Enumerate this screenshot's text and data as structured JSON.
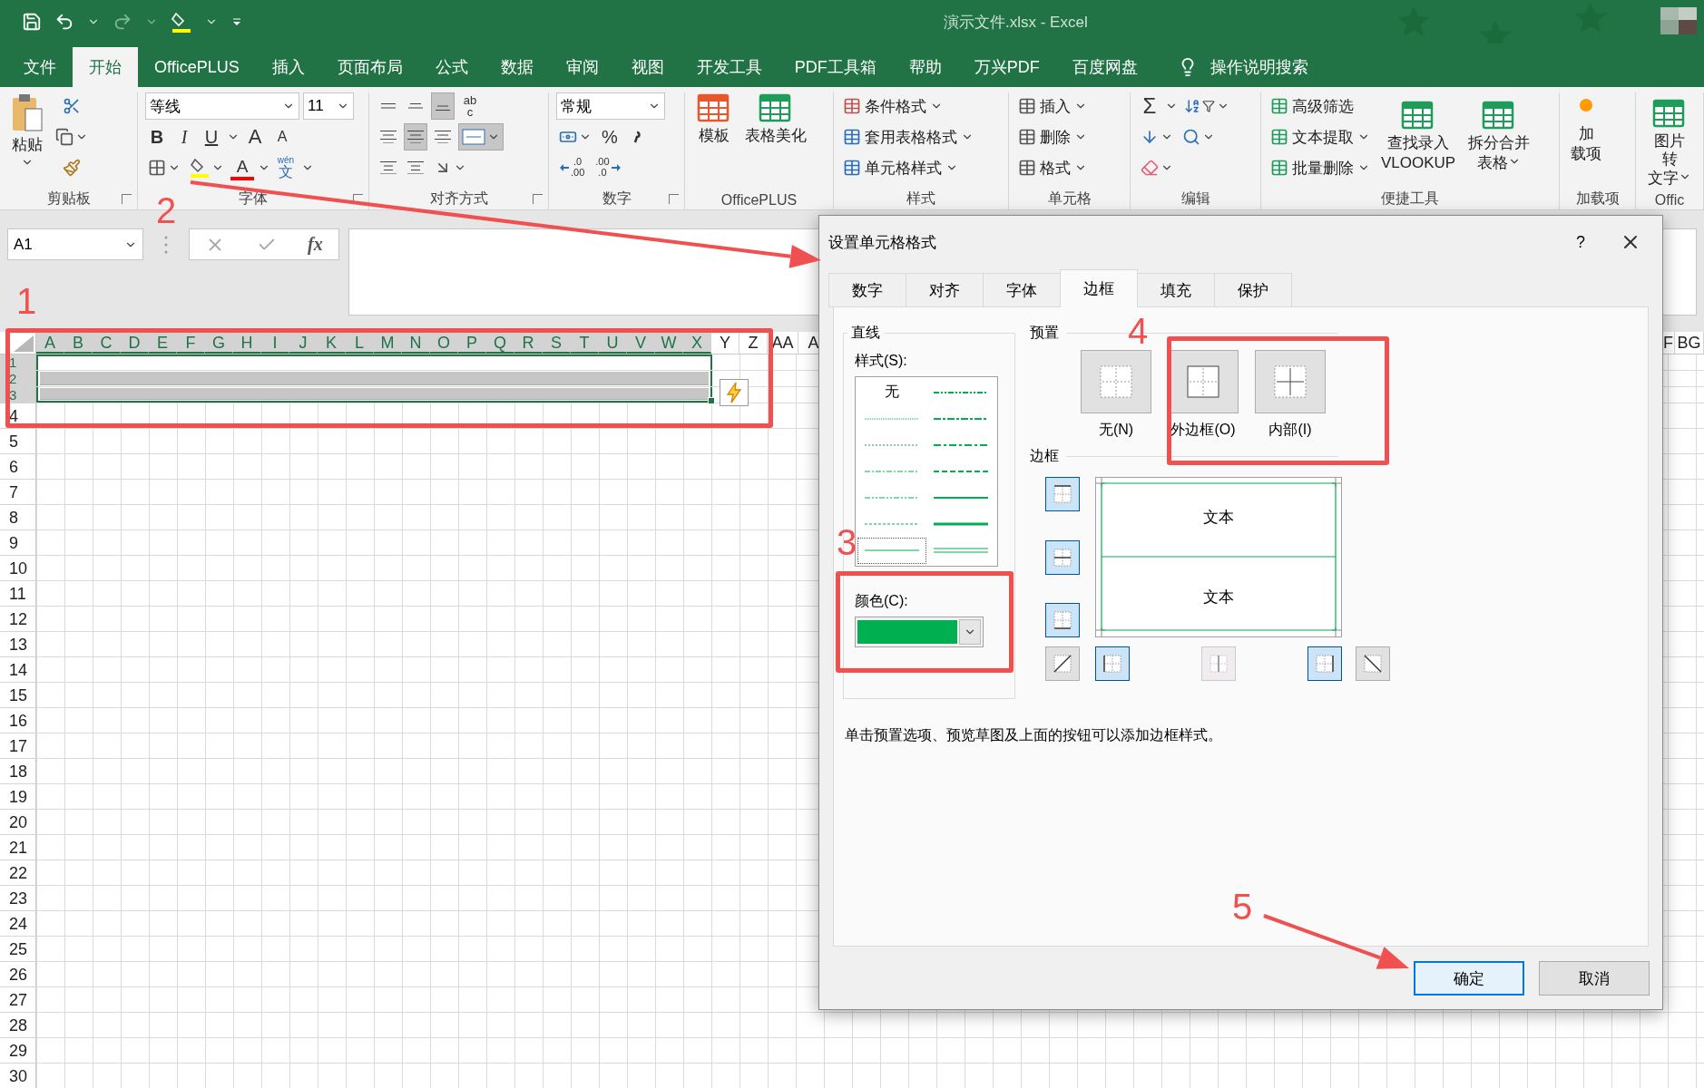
{
  "title_bar": {
    "title": "演示文件.xlsx  -  Excel"
  },
  "menu_tabs": [
    {
      "label": "文件",
      "selected": false
    },
    {
      "label": "开始",
      "selected": true
    },
    {
      "label": "OfficePLUS",
      "selected": false
    },
    {
      "label": "插入",
      "selected": false
    },
    {
      "label": "页面布局",
      "selected": false
    },
    {
      "label": "公式",
      "selected": false
    },
    {
      "label": "数据",
      "selected": false
    },
    {
      "label": "审阅",
      "selected": false
    },
    {
      "label": "视图",
      "selected": false
    },
    {
      "label": "开发工具",
      "selected": false
    },
    {
      "label": "PDF工具箱",
      "selected": false
    },
    {
      "label": "帮助",
      "selected": false
    },
    {
      "label": "万兴PDF",
      "selected": false
    },
    {
      "label": "百度网盘",
      "selected": false
    }
  ],
  "tell_me": "操作说明搜索",
  "ribbon": {
    "clipboard": {
      "paste": "粘贴",
      "label": "剪贴板"
    },
    "font": {
      "name": "等线",
      "size": "11",
      "bold": "B",
      "italic": "I",
      "underline": "U",
      "grow": "A",
      "shrink": "A",
      "color_button": "A",
      "phonetic_top": "wén",
      "phonetic": "文",
      "label": "字体"
    },
    "alignment": {
      "wrap_top": "ab",
      "wrap_bottom": "c",
      "label": "对齐方式"
    },
    "number": {
      "format": "常规",
      "percent": "%",
      "inc_decimal": [
        ".0",
        ".00"
      ],
      "dec_decimal": [
        ".00",
        ".0"
      ],
      "label": "数字"
    },
    "officeplus": {
      "buttons": [
        "模板",
        "表格美化"
      ],
      "label": "OfficePLUS"
    },
    "styles": {
      "buttons": [
        "条件格式",
        "套用表格格式",
        "单元格样式"
      ],
      "label": "样式"
    },
    "cells": {
      "buttons": [
        "插入",
        "删除",
        "格式"
      ],
      "label": "单元格"
    },
    "editing": {
      "sum": "Σ",
      "label": "编辑"
    },
    "tools": {
      "small": [
        "高级筛选",
        "文本提取",
        "批量删除"
      ],
      "large": [
        [
          "查找录入",
          "VLOOKUP"
        ],
        [
          "拆分合并",
          "表格"
        ]
      ],
      "label": "便捷工具"
    },
    "addins": {
      "button": [
        "加",
        "载项"
      ],
      "label": "加载项"
    },
    "picture_text": {
      "button": [
        "图片转",
        "文字"
      ],
      "label": "Offic"
    }
  },
  "formula_bar": {
    "name_box": "A1",
    "fx": "fx"
  },
  "sheet": {
    "columns": [
      {
        "label": "A",
        "selected": true
      },
      {
        "label": "B",
        "selected": true
      },
      {
        "label": "C",
        "selected": true
      },
      {
        "label": "D",
        "selected": true
      },
      {
        "label": "E",
        "selected": true
      },
      {
        "label": "F",
        "selected": true
      },
      {
        "label": "G",
        "selected": true
      },
      {
        "label": "H",
        "selected": true
      },
      {
        "label": "I",
        "selected": true
      },
      {
        "label": "J",
        "selected": true
      },
      {
        "label": "K",
        "selected": true
      },
      {
        "label": "L",
        "selected": true
      },
      {
        "label": "M",
        "selected": true
      },
      {
        "label": "N",
        "selected": true
      },
      {
        "label": "O",
        "selected": true
      },
      {
        "label": "P",
        "selected": true
      },
      {
        "label": "Q",
        "selected": true
      },
      {
        "label": "R",
        "selected": true
      },
      {
        "label": "S",
        "selected": true
      },
      {
        "label": "T",
        "selected": true
      },
      {
        "label": "U",
        "selected": true
      },
      {
        "label": "V",
        "selected": true
      },
      {
        "label": "W",
        "selected": true
      },
      {
        "label": "X",
        "selected": true
      },
      {
        "label": "Y",
        "selected": false
      },
      {
        "label": "Z",
        "selected": false
      },
      {
        "label": "AA",
        "selected": false
      },
      {
        "label": "A",
        "selected": false
      }
    ],
    "right_columns": [
      "F",
      "BG"
    ],
    "rows": [
      {
        "label": "1",
        "selected": true,
        "filled": false
      },
      {
        "label": "2",
        "selected": true,
        "filled": true
      },
      {
        "label": "3",
        "selected": true,
        "filled": true
      },
      {
        "label": "4",
        "selected": false,
        "filled": false
      },
      {
        "label": "5",
        "selected": false,
        "filled": false
      },
      {
        "label": "6",
        "selected": false,
        "filled": false
      },
      {
        "label": "7",
        "selected": false,
        "filled": false
      },
      {
        "label": "8",
        "selected": false,
        "filled": false
      },
      {
        "label": "9",
        "selected": false,
        "filled": false
      },
      {
        "label": "10",
        "selected": false,
        "filled": false
      },
      {
        "label": "11",
        "selected": false,
        "filled": false
      },
      {
        "label": "12",
        "selected": false,
        "filled": false
      },
      {
        "label": "13",
        "selected": false,
        "filled": false
      },
      {
        "label": "14",
        "selected": false,
        "filled": false
      },
      {
        "label": "15",
        "selected": false,
        "filled": false
      },
      {
        "label": "16",
        "selected": false,
        "filled": false
      },
      {
        "label": "17",
        "selected": false,
        "filled": false
      },
      {
        "label": "18",
        "selected": false,
        "filled": false
      },
      {
        "label": "19",
        "selected": false,
        "filled": false
      },
      {
        "label": "20",
        "selected": false,
        "filled": false
      },
      {
        "label": "21",
        "selected": false,
        "filled": false
      },
      {
        "label": "22",
        "selected": false,
        "filled": false
      },
      {
        "label": "23",
        "selected": false,
        "filled": false
      },
      {
        "label": "24",
        "selected": false,
        "filled": false
      },
      {
        "label": "25",
        "selected": false,
        "filled": false
      },
      {
        "label": "26",
        "selected": false,
        "filled": false
      },
      {
        "label": "27",
        "selected": false,
        "filled": false
      },
      {
        "label": "28",
        "selected": false,
        "filled": false
      },
      {
        "label": "29",
        "selected": false,
        "filled": false
      },
      {
        "label": "30",
        "selected": false,
        "filled": false
      }
    ]
  },
  "dialog": {
    "title": "设置单元格格式",
    "help": "?",
    "tabs": [
      {
        "label": "数字",
        "selected": false
      },
      {
        "label": "对齐",
        "selected": false
      },
      {
        "label": "字体",
        "selected": false
      },
      {
        "label": "边框",
        "selected": true
      },
      {
        "label": "填充",
        "selected": false
      },
      {
        "label": "保护",
        "selected": false
      }
    ],
    "line": {
      "title": "直线",
      "style_label": "样式(S):",
      "styles": [
        {
          "kind": "none",
          "label": "无",
          "selected": false
        },
        {
          "kind": "hair",
          "selected": false
        },
        {
          "kind": "dotted",
          "selected": false
        },
        {
          "kind": "dash_dot",
          "selected": false
        },
        {
          "kind": "dash_dot_dot",
          "selected": false
        },
        {
          "kind": "dashed",
          "selected": false
        },
        {
          "kind": "thin",
          "selected": true
        },
        {
          "kind": "medium_dash_dot_dot",
          "selected": false
        },
        {
          "kind": "slant_dash_dot",
          "selected": false
        },
        {
          "kind": "medium_dash_dot",
          "selected": false
        },
        {
          "kind": "medium_dashed",
          "selected": false
        },
        {
          "kind": "medium",
          "selected": false
        },
        {
          "kind": "thick",
          "selected": false
        },
        {
          "kind": "double",
          "selected": false
        }
      ],
      "color_label": "颜色(C):",
      "color": "#00b050"
    },
    "presets": {
      "title": "预置",
      "items": [
        {
          "kind": "none",
          "label": "无(N)"
        },
        {
          "kind": "outline",
          "label": "外边框(O)"
        },
        {
          "kind": "inside",
          "label": "内部(I)"
        }
      ]
    },
    "border": {
      "title": "边框",
      "preview_texts": [
        "文本",
        "文本"
      ],
      "buttons": [
        {
          "kind": "top",
          "selected": true,
          "disabled": false
        },
        {
          "kind": "inside_h",
          "selected": true,
          "disabled": false
        },
        {
          "kind": "bottom",
          "selected": true,
          "disabled": false
        },
        {
          "kind": "diag_up",
          "selected": false,
          "disabled": false
        },
        {
          "kind": "left",
          "selected": true,
          "disabled": false
        },
        {
          "kind": "inside_v",
          "selected": false,
          "disabled": true
        },
        {
          "kind": "right",
          "selected": true,
          "disabled": false
        },
        {
          "kind": "diag_down",
          "selected": false,
          "disabled": false
        }
      ]
    },
    "hint": "单击预置选项、预览草图及上面的按钮可以添加边框样式。",
    "buttons": [
      {
        "label": "确定",
        "default": true
      },
      {
        "label": "取消",
        "default": false
      }
    ]
  },
  "annotations": [
    {
      "label": "1",
      "kind": "box"
    },
    {
      "label": "2",
      "kind": "arrow"
    },
    {
      "label": "3",
      "kind": "box"
    },
    {
      "label": "4",
      "kind": "box"
    },
    {
      "label": "5",
      "kind": "arrow"
    }
  ]
}
